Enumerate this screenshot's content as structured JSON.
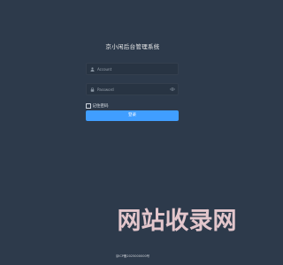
{
  "login": {
    "title": "京小闲后台管理系统",
    "username": {
      "placeholder": "Account",
      "icon": "user-icon"
    },
    "password": {
      "placeholder": "Password",
      "icon": "lock-icon",
      "toggle_icon": "eye-icon"
    },
    "remember_label": "记住密码",
    "submit_label": "登录"
  },
  "watermark": {
    "text": "网站收录网",
    "icon": "watermark-logo"
  },
  "footer": {
    "text": "京ICP备2025000000号"
  },
  "colors": {
    "background": "#2d3a4b",
    "input_background": "#283443",
    "primary": "#409eff",
    "watermark": "#f3d2d7"
  }
}
